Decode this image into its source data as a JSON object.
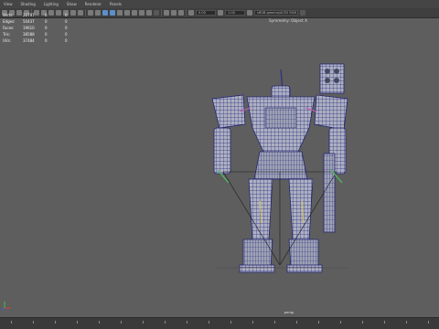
{
  "menubar": [
    "View",
    "Shading",
    "Lighting",
    "Show",
    "Renderer",
    "Panels"
  ],
  "toolbar": {
    "lock_field": "0.00",
    "value_field": "1.00",
    "colorspace_field": "sRGB gamma/ACES RGB"
  },
  "stats": {
    "rows": [
      {
        "label": "Verts:",
        "value": "22797",
        "sel": "0",
        "comp": "0"
      },
      {
        "label": "Edges:",
        "value": "50437",
        "sel": "0",
        "comp": "0"
      },
      {
        "label": "Faces:",
        "value": "19610",
        "sel": "0",
        "comp": "0"
      },
      {
        "label": "Tris:",
        "value": "38588",
        "sel": "0",
        "comp": "0"
      },
      {
        "label": "UVs:",
        "value": "37484",
        "sel": "0",
        "comp": "0"
      }
    ]
  },
  "viewport": {
    "object_label": "Symmetry: Object X",
    "camera": "persp"
  },
  "colors": {
    "viewport_bg": "#5e5e5e",
    "wireframe": "#2b2f86",
    "mesh": "#b6b8c6",
    "selected_highlight": "#5a8fc8"
  }
}
